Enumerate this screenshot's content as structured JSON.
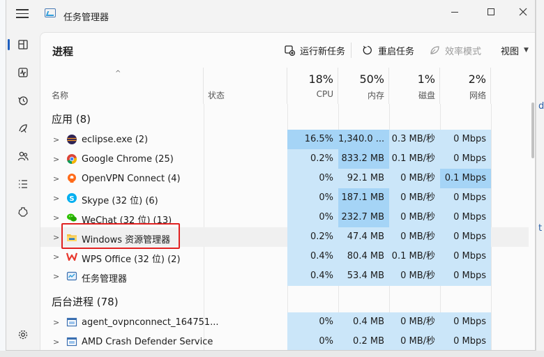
{
  "window": {
    "title": "任务管理器"
  },
  "nav": {
    "items": [
      "processes",
      "performance",
      "app-history",
      "startup-apps",
      "users",
      "details",
      "services"
    ],
    "settings": "settings"
  },
  "page": {
    "title": "进程"
  },
  "toolbar": {
    "run_new_task": "运行新任务",
    "restart_task": "重启任务",
    "efficiency_mode": "效率模式",
    "view": "视图"
  },
  "columns": {
    "name": "名称",
    "status": "状态",
    "cpu": {
      "pct": "18%",
      "label": "CPU"
    },
    "memory": {
      "pct": "50%",
      "label": "内存"
    },
    "disk": {
      "pct": "1%",
      "label": "磁盘"
    },
    "network": {
      "pct": "2%",
      "label": "网络"
    }
  },
  "groups": {
    "apps": "应用 (8)",
    "background": "后台进程 (78)"
  },
  "rows": [
    {
      "name": "eclipse.exe (2)",
      "cpu": "16.5%",
      "mem": "1,340.0 ...",
      "disk": "0.3 MB/秒",
      "net": "0 Mbps",
      "icon": "eclipse-icon"
    },
    {
      "name": "Google Chrome (25)",
      "cpu": "0.2%",
      "mem": "833.2 MB",
      "disk": "0.1 MB/秒",
      "net": "0 Mbps",
      "icon": "chrome-icon"
    },
    {
      "name": "OpenVPN Connect (4)",
      "cpu": "0%",
      "mem": "92.1 MB",
      "disk": "0 MB/秒",
      "net": "0.1 Mbps",
      "icon": "openvpn-icon"
    },
    {
      "name": "Skype (32 位) (6)",
      "cpu": "0%",
      "mem": "187.1 MB",
      "disk": "0 MB/秒",
      "net": "0 Mbps",
      "icon": "skype-icon"
    },
    {
      "name": "WeChat (32 位) (13)",
      "cpu": "0%",
      "mem": "232.7 MB",
      "disk": "0 MB/秒",
      "net": "0 Mbps",
      "icon": "wechat-icon"
    },
    {
      "name": "Windows 资源管理器",
      "cpu": "0.2%",
      "mem": "47.4 MB",
      "disk": "0 MB/秒",
      "net": "0 Mbps",
      "icon": "folder-icon"
    },
    {
      "name": "WPS Office (32 位) (2)",
      "cpu": "0.4%",
      "mem": "80.4 MB",
      "disk": "0.1 MB/秒",
      "net": "0 Mbps",
      "icon": "wps-icon"
    },
    {
      "name": "任务管理器",
      "cpu": "0.4%",
      "mem": "53.4 MB",
      "disk": "0 MB/秒",
      "net": "0 Mbps",
      "icon": "task-manager-icon"
    }
  ],
  "bg_rows": [
    {
      "name": "agent_ovpnconnect_164751...",
      "cpu": "0%",
      "mem": "0.4 MB",
      "disk": "0 MB/秒",
      "net": "0 Mbps",
      "icon": "service-icon"
    },
    {
      "name": "AMD Crash Defender Service",
      "cpu": "0%",
      "mem": "0.2 MB",
      "disk": "0 MB/秒",
      "net": "0 Mbps",
      "icon": "service-icon"
    }
  ],
  "colors": {
    "heat_light": "#cbe6f9",
    "heat_medium": "#a5d4f6",
    "highlight": "#e02020",
    "accent": "#1e5fbf"
  }
}
